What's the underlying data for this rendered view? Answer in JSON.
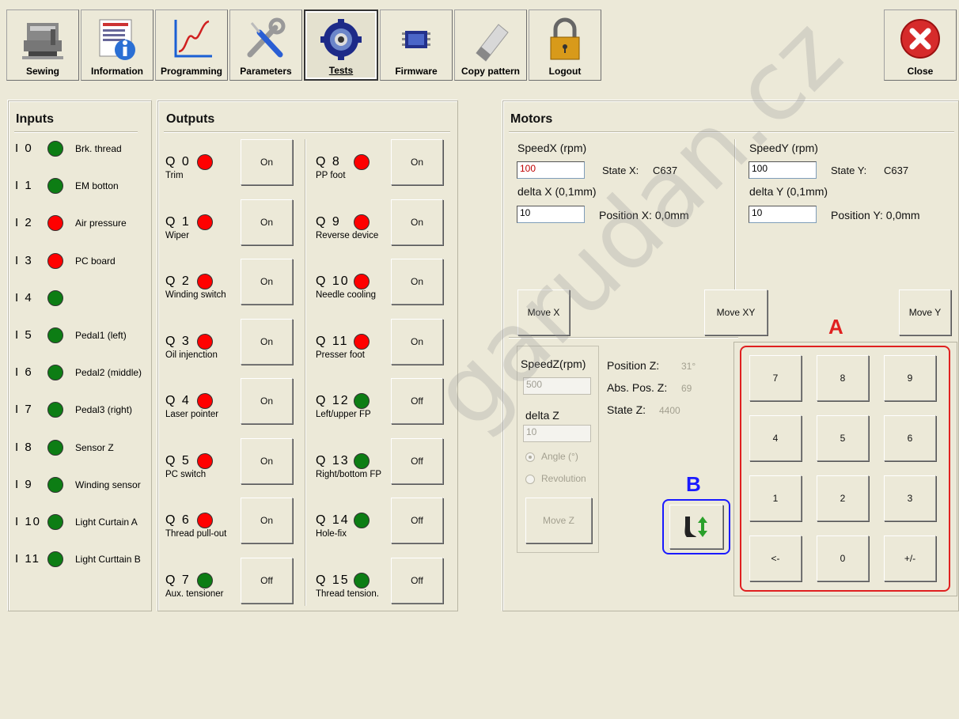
{
  "toolbar": {
    "sewing": "Sewing",
    "information": "Information",
    "programming": "Programming",
    "parameters": "Parameters",
    "tests": "Tests",
    "firmware": "Firmware",
    "copy_pattern": "Copy pattern",
    "logout": "Logout",
    "close": "Close"
  },
  "inputs": {
    "title": "Inputs",
    "items": [
      {
        "id": "I 0",
        "label": "Brk. thread",
        "state": "green"
      },
      {
        "id": "I 1",
        "label": "EM botton",
        "state": "green"
      },
      {
        "id": "I 2",
        "label": "Air pressure",
        "state": "red"
      },
      {
        "id": "I 3",
        "label": "PC board",
        "state": "red"
      },
      {
        "id": "I 4",
        "label": "",
        "state": "green"
      },
      {
        "id": "I 5",
        "label": "Pedal1 (left)",
        "state": "green"
      },
      {
        "id": "I 6",
        "label": "Pedal2 (middle)",
        "state": "green"
      },
      {
        "id": "I 7",
        "label": "Pedal3 (right)",
        "state": "green"
      },
      {
        "id": "I 8",
        "label": "Sensor Z",
        "state": "green"
      },
      {
        "id": "I 9",
        "label": "Winding sensor",
        "state": "green"
      },
      {
        "id": "I 10",
        "label": "Light Curtain A",
        "state": "green"
      },
      {
        "id": "I 11",
        "label": "Light Curttain B",
        "state": "green"
      }
    ]
  },
  "outputs": {
    "title": "Outputs",
    "left": [
      {
        "id": "Q 0",
        "label": "Trim",
        "state": "red",
        "button": "On"
      },
      {
        "id": "Q 1",
        "label": "Wiper",
        "state": "red",
        "button": "On"
      },
      {
        "id": "Q 2",
        "label": "Winding switch",
        "state": "red",
        "button": "On"
      },
      {
        "id": "Q 3",
        "label": "Oil injenction",
        "state": "red",
        "button": "On"
      },
      {
        "id": "Q 4",
        "label": "Laser pointer",
        "state": "red",
        "button": "On"
      },
      {
        "id": "Q 5",
        "label": "PC switch",
        "state": "red",
        "button": "On"
      },
      {
        "id": "Q 6",
        "label": "Thread pull-out",
        "state": "red",
        "button": "On"
      },
      {
        "id": "Q 7",
        "label": "Aux. tensioner",
        "state": "green",
        "button": "Off"
      }
    ],
    "right": [
      {
        "id": "Q 8",
        "label": "PP foot",
        "state": "red",
        "button": "On"
      },
      {
        "id": "Q 9",
        "label": "Reverse device",
        "state": "red",
        "button": "On"
      },
      {
        "id": "Q 10",
        "label": "Needle cooling",
        "state": "red",
        "button": "On"
      },
      {
        "id": "Q 11",
        "label": "Presser foot",
        "state": "red",
        "button": "On"
      },
      {
        "id": "Q 12",
        "label": "Left/upper FP",
        "state": "green",
        "button": "Off"
      },
      {
        "id": "Q 13",
        "label": "Right/bottom FP",
        "state": "green",
        "button": "Off"
      },
      {
        "id": "Q 14",
        "label": "Hole-fix",
        "state": "green",
        "button": "Off"
      },
      {
        "id": "Q 15",
        "label": "Thread tension.",
        "state": "green",
        "button": "Off"
      }
    ]
  },
  "motors": {
    "title": "Motors",
    "x": {
      "speed_label": "SpeedX (rpm)",
      "speed_value": "100",
      "state_label": "State X:",
      "state_value": "C637",
      "delta_label": "delta X (0,1mm)",
      "delta_value": "10",
      "position": "Position X: 0,0mm"
    },
    "y": {
      "speed_label": "SpeedY (rpm)",
      "speed_value": "100",
      "state_label": "State Y:",
      "state_value": "C637",
      "delta_label": "delta Y (0,1mm)",
      "delta_value": "10",
      "position": "Position Y: 0,0mm"
    },
    "move_x": "Move X",
    "move_xy": "Move XY",
    "move_y": "Move Y",
    "z": {
      "speed_label": "SpeedZ(rpm)",
      "speed_value": "500",
      "delta_label": "delta Z",
      "delta_value": "10",
      "position_label": "Position Z:",
      "position_value": "31°",
      "abs_label": "Abs. Pos. Z:",
      "abs_value": "69",
      "state_label": "State Z:",
      "state_value": "4400",
      "angle_label": "Angle (°)",
      "revolution_label": "Revolution",
      "move_z": "Move Z"
    }
  },
  "keypad": {
    "keys": [
      "7",
      "8",
      "9",
      "4",
      "5",
      "6",
      "1",
      "2",
      "3",
      "<-",
      "0",
      "+/-"
    ]
  },
  "annotations": {
    "a": "A",
    "b": "B",
    "a_color": "#e02020",
    "b_color": "#1a1aff"
  },
  "watermark": "garudan.cz"
}
